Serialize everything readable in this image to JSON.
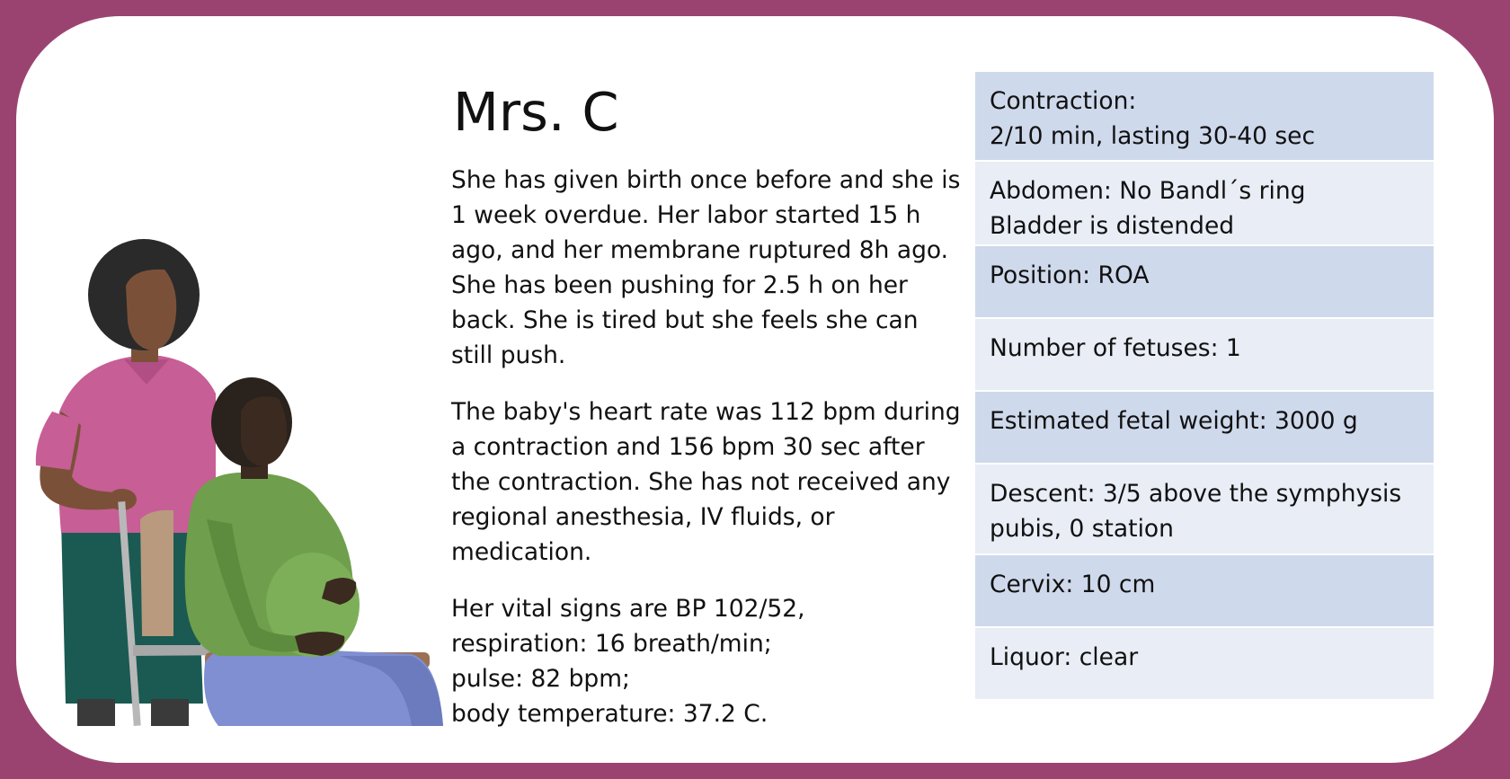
{
  "patient": {
    "name": "Mrs. C",
    "history": [
      "She has given birth once before and she is 1 week overdue. Her labor started 15 h ago, and her membrane ruptured 8h ago. She has been pushing for 2.5 h on her back. She is tired but she feels she can still push.",
      "The baby's heart rate was 112 bpm during a contraction and 156 bpm 30 sec after the contraction. She has not received any regional anesthesia, IV fluids, or medication."
    ],
    "vitals": [
      "Her vital signs are BP 102/52,",
      "respiration: 16 breath/min;",
      "pulse: 82 bpm;",
      "body temperature: 37.2 C."
    ]
  },
  "findings": [
    {
      "line1": "Contraction:",
      "line2": "2/10 min, lasting 30-40 sec"
    },
    {
      "line1": "Abdomen: No Bandl´s ring",
      "line2": "Bladder is distended"
    },
    {
      "line1": "Position: ROA",
      "line2": ""
    },
    {
      "line1": "Number of fetuses: 1",
      "line2": ""
    },
    {
      "line1": "Estimated fetal weight: 3000 g",
      "line2": ""
    },
    {
      "line1": "Descent: 3/5 above the symphysis",
      "line2": "pubis, 0 station"
    },
    {
      "line1": "Cervix: 10 cm",
      "line2": ""
    },
    {
      "line1": "Liquor: clear",
      "line2": ""
    }
  ],
  "colors": {
    "frame": "#9b4370",
    "row_dark": "#cfd9ec",
    "row_light": "#e8edf6"
  },
  "icons": [
    "caregiver-illustration",
    "pregnant-woman-in-chair-illustration"
  ]
}
